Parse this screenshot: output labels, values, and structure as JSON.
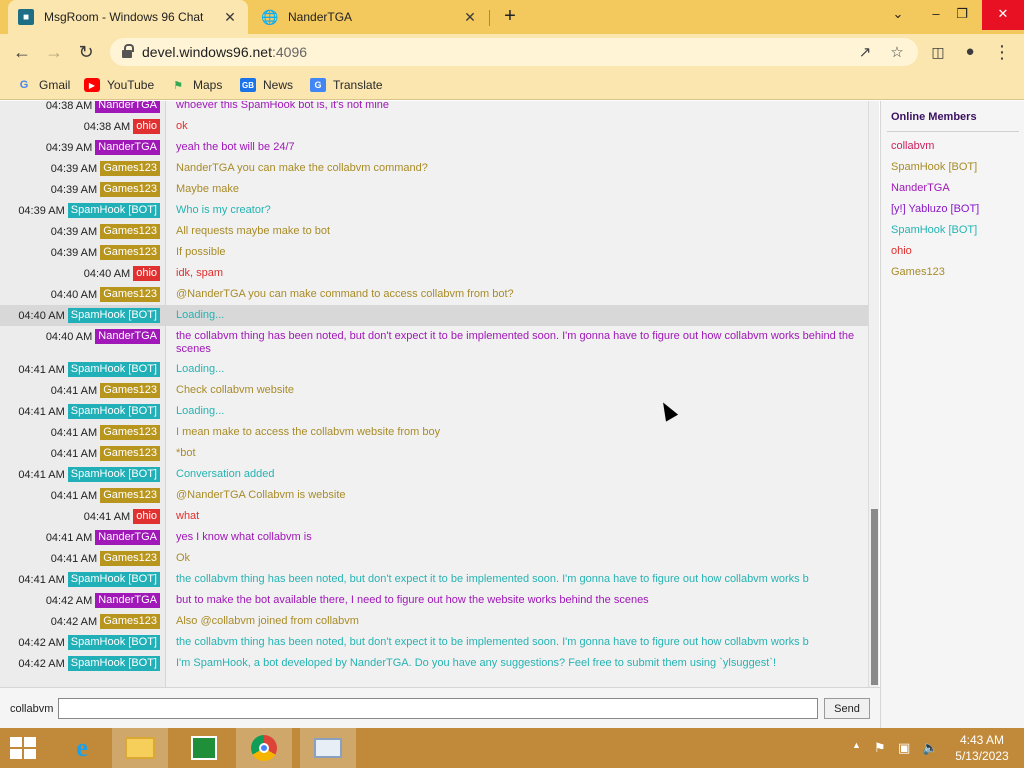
{
  "browser": {
    "tabs": [
      {
        "title": "MsgRoom - Windows 96 Chat",
        "icon": "windows96-icon",
        "active": true
      },
      {
        "title": "NanderTGA",
        "icon": "globe-icon",
        "active": false
      }
    ],
    "url_host": "devel.windows96.net",
    "url_port": ":4096",
    "bookmarks": [
      {
        "label": "Gmail",
        "icon": "gmail-icon"
      },
      {
        "label": "YouTube",
        "icon": "youtube-icon"
      },
      {
        "label": "Maps",
        "icon": "maps-icon"
      },
      {
        "label": "News",
        "icon": "news-icon"
      },
      {
        "label": "Translate",
        "icon": "translate-icon"
      }
    ]
  },
  "chat": {
    "messages": [
      {
        "time": "04:38 AM",
        "user": "NanderTGA",
        "cls": "nander",
        "text": "whoever this SpamHook bot is, it's not mine"
      },
      {
        "time": "04:38 AM",
        "user": "ohio",
        "cls": "ohio",
        "text": "ok"
      },
      {
        "time": "04:39 AM",
        "user": "NanderTGA",
        "cls": "nander",
        "text": "yeah the bot will be 24/7"
      },
      {
        "time": "04:39 AM",
        "user": "Games123",
        "cls": "games",
        "text": "NanderTGA you can make the collabvm command?"
      },
      {
        "time": "04:39 AM",
        "user": "Games123",
        "cls": "games",
        "text": "Maybe make"
      },
      {
        "time": "04:39 AM",
        "user": "SpamHook [BOT]",
        "cls": "spam",
        "text": "Who is my creator?"
      },
      {
        "time": "04:39 AM",
        "user": "Games123",
        "cls": "games",
        "text": "All requests maybe make to bot"
      },
      {
        "time": "04:39 AM",
        "user": "Games123",
        "cls": "games",
        "text": "If possible"
      },
      {
        "time": "04:40 AM",
        "user": "ohio",
        "cls": "ohio",
        "text": "idk, spam"
      },
      {
        "time": "04:40 AM",
        "user": "Games123",
        "cls": "games",
        "text": "@NanderTGA you can make command to access collabvm from bot?"
      },
      {
        "time": "04:40 AM",
        "user": "SpamHook [BOT]",
        "cls": "spam",
        "text": "Loading..."
      },
      {
        "time": "04:40 AM",
        "user": "NanderTGA",
        "cls": "nander",
        "text": "the collabvm thing has been noted, but don't expect it to be implemented soon. I'm gonna have to figure out how collabvm works behind the scenes"
      },
      {
        "time": "04:41 AM",
        "user": "SpamHook [BOT]",
        "cls": "spam",
        "text": "Loading..."
      },
      {
        "time": "04:41 AM",
        "user": "Games123",
        "cls": "games",
        "text": "Check collabvm website"
      },
      {
        "time": "04:41 AM",
        "user": "SpamHook [BOT]",
        "cls": "spam",
        "text": "Loading..."
      },
      {
        "time": "04:41 AM",
        "user": "Games123",
        "cls": "games",
        "text": "I mean make to access the collabvm website from boy"
      },
      {
        "time": "04:41 AM",
        "user": "Games123",
        "cls": "games",
        "text": "*bot"
      },
      {
        "time": "04:41 AM",
        "user": "SpamHook [BOT]",
        "cls": "spam",
        "text": "Conversation added"
      },
      {
        "time": "04:41 AM",
        "user": "Games123",
        "cls": "games",
        "text": "@NanderTGA Collabvm is website"
      },
      {
        "time": "04:41 AM",
        "user": "ohio",
        "cls": "ohio",
        "text": "what"
      },
      {
        "time": "04:41 AM",
        "user": "NanderTGA",
        "cls": "nander",
        "text": "yes I know what collabvm is"
      },
      {
        "time": "04:41 AM",
        "user": "Games123",
        "cls": "games",
        "text": "Ok"
      },
      {
        "time": "04:41 AM",
        "user": "SpamHook [BOT]",
        "cls": "spam",
        "text": "the collabvm thing has been noted, but don't expect it to be implemented soon. I'm gonna have to figure out how collabvm works b"
      },
      {
        "time": "04:42 AM",
        "user": "NanderTGA",
        "cls": "nander",
        "text": "but to make the bot available there, I need to figure out how the website works behind the scenes"
      },
      {
        "time": "04:42 AM",
        "user": "Games123",
        "cls": "games",
        "text": "Also @collabvm joined from collabvm"
      },
      {
        "time": "04:42 AM",
        "user": "SpamHook [BOT]",
        "cls": "spam",
        "text": "the collabvm thing has been noted, but don't expect it to be implemented soon. I'm gonna have to figure out how collabvm works b"
      },
      {
        "time": "04:42 AM",
        "user": "SpamHook [BOT]",
        "cls": "spam",
        "text": "I'm SpamHook, a bot developed by NanderTGA. Do you have any suggestions? Feel free to submit them using `ylsuggest`!"
      }
    ],
    "members_title": "Online Members",
    "members": [
      {
        "name": "collabvm",
        "cls": "collab"
      },
      {
        "name": "SpamHook [BOT]",
        "cls": "games"
      },
      {
        "name": "NanderTGA",
        "cls": "nander"
      },
      {
        "name": "[y!] Yabluzo [BOT]",
        "cls": "yabluzo"
      },
      {
        "name": "SpamHook [BOT]",
        "cls": "spam"
      },
      {
        "name": "ohio",
        "cls": "ohio"
      },
      {
        "name": "Games123",
        "cls": "games"
      }
    ],
    "input": {
      "username": "collabvm",
      "value": "",
      "send_label": "Send"
    }
  },
  "taskbar": {
    "apps": [
      {
        "name": "start-button",
        "icon": "windows-logo-icon"
      },
      {
        "name": "internet-explorer",
        "icon": "ie-icon"
      },
      {
        "name": "file-explorer",
        "icon": "folder-icon"
      },
      {
        "name": "store",
        "icon": "store-icon"
      },
      {
        "name": "chrome",
        "icon": "chrome-icon"
      },
      {
        "name": "task-manager",
        "icon": "chart-icon"
      }
    ],
    "clock_time": "4:43 AM",
    "clock_date": "5/13/2023"
  },
  "colors": {
    "nander": "#a018b8",
    "ohio": "#e03030",
    "games": "#b8961e",
    "spam": "#22b0b8",
    "tab_strip": "#f3c95e",
    "taskbar": "#c08a3a"
  }
}
